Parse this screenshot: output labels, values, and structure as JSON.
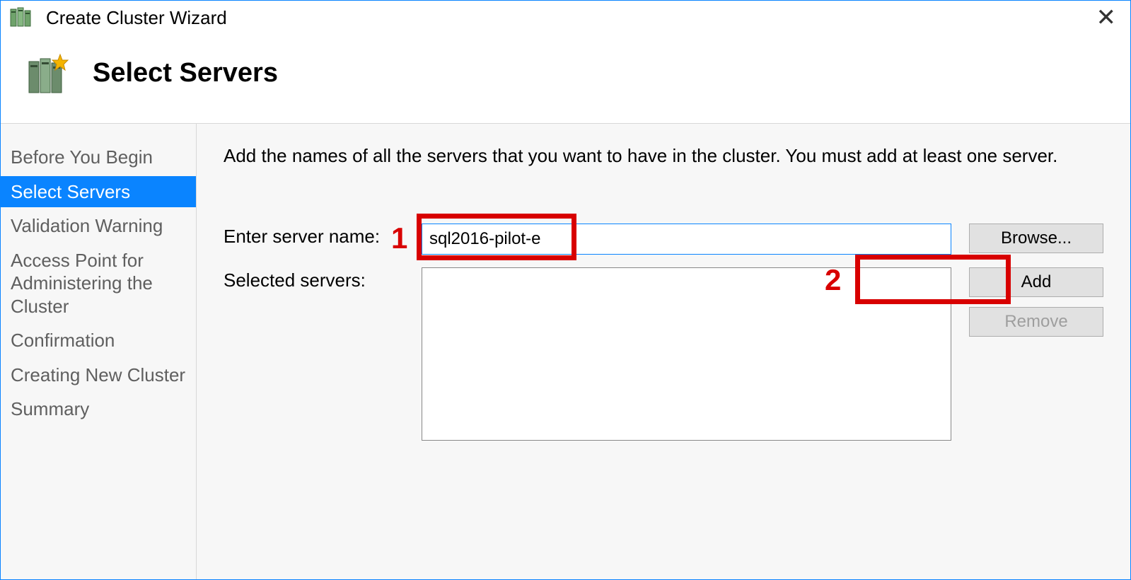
{
  "window": {
    "title": "Create Cluster Wizard"
  },
  "header": {
    "page_title": "Select Servers"
  },
  "sidebar": {
    "steps": [
      {
        "label": "Before You Begin",
        "active": false
      },
      {
        "label": "Select Servers",
        "active": true
      },
      {
        "label": "Validation Warning",
        "active": false
      },
      {
        "label": "Access Point for Administering the Cluster",
        "active": false
      },
      {
        "label": "Confirmation",
        "active": false
      },
      {
        "label": "Creating New Cluster",
        "active": false
      },
      {
        "label": "Summary",
        "active": false
      }
    ]
  },
  "main": {
    "instructions": "Add the names of all the servers that you want to have in the cluster. You must add at least one server.",
    "enter_label": "Enter server name:",
    "selected_label": "Selected servers:",
    "server_name_value": "sql2016-pilot-e",
    "buttons": {
      "browse": "Browse...",
      "add": "Add",
      "remove": "Remove"
    }
  },
  "annotations": {
    "num1": "1",
    "num2": "2"
  }
}
